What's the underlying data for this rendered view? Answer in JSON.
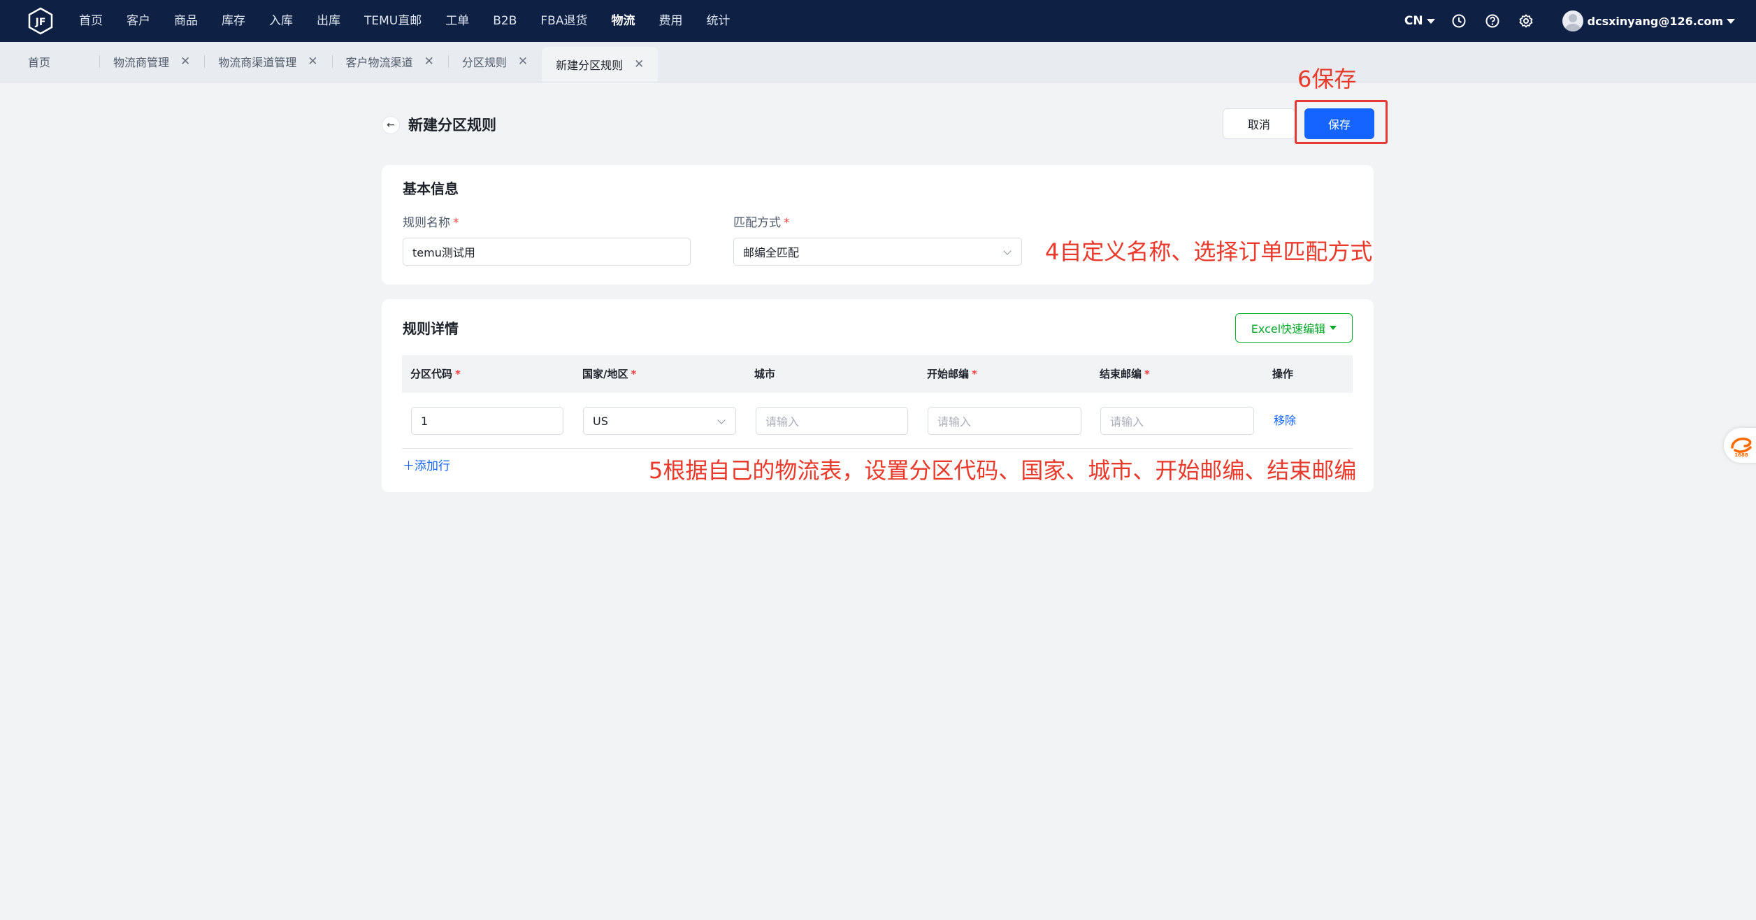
{
  "topnav": {
    "items": [
      "首页",
      "客户",
      "商品",
      "库存",
      "入库",
      "出库",
      "TEMU直邮",
      "工单",
      "B2B",
      "FBA退货",
      "物流",
      "费用",
      "统计"
    ],
    "active_index": 10,
    "lang": "CN",
    "user": "dcsxinyang@126.com"
  },
  "tabs": [
    {
      "label": "首页",
      "closable": false
    },
    {
      "label": "物流商管理",
      "closable": true
    },
    {
      "label": "物流商渠道管理",
      "closable": true
    },
    {
      "label": "客户物流渠道",
      "closable": true
    },
    {
      "label": "分区规则",
      "closable": true
    },
    {
      "label": "新建分区规则",
      "closable": true,
      "active": true
    }
  ],
  "header": {
    "title": "新建分区规则",
    "cancel_label": "取消",
    "save_label": "保存"
  },
  "basic_info": {
    "title": "基本信息",
    "rule_name_label": "规则名称",
    "rule_name_value": "temu测试用",
    "match_label": "匹配方式",
    "match_value": "邮编全匹配"
  },
  "rule_detail": {
    "title": "规则详情",
    "excel_label": "Excel快速编辑",
    "columns": [
      "分区代码",
      "国家/地区",
      "城市",
      "开始邮编",
      "结束邮编",
      "操作"
    ],
    "row": {
      "zone_code": "1",
      "country": "US",
      "city_placeholder": "请输入",
      "start_zip_placeholder": "请输入",
      "end_zip_placeholder": "请输入",
      "remove_label": "移除"
    },
    "add_row_label": "添加行"
  },
  "annotations": {
    "save_note": "6保存",
    "basic_note": "4自定义名称、选择订单匹配方式",
    "detail_note": "5根据自己的物流表，设置分区代码、国家、城市、开始邮编、结束邮编"
  },
  "colors": {
    "nav_bg": "#0e2144",
    "primary": "#1664ff",
    "annotation_red": "#e8392b",
    "excel_green": "#00a827"
  }
}
